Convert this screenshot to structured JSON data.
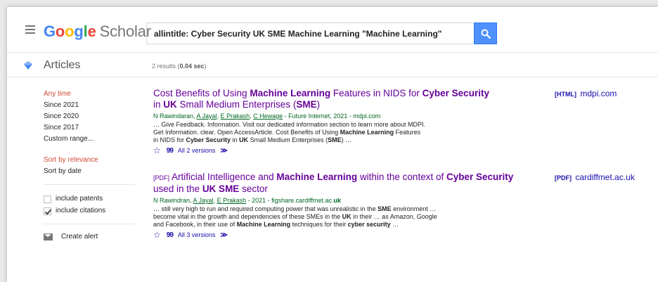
{
  "header": {
    "logo": {
      "google_letters": [
        "G",
        "o",
        "o",
        "g",
        "l",
        "e"
      ],
      "scholar": "Scholar"
    },
    "search": {
      "query": "allintitle: Cyber Security UK SME Machine Learning \"Machine Learning\""
    }
  },
  "subheader": {
    "section_label": "Articles",
    "results_prefix": "2 results (",
    "results_time": "0.04 sec",
    "results_suffix": ")"
  },
  "sidebar": {
    "time_filters": [
      "Any time",
      "Since 2021",
      "Since 2020",
      "Since 2017",
      "Custom range..."
    ],
    "sort_options": [
      "Sort by relevance",
      "Sort by date"
    ],
    "checks": [
      {
        "label": "include patents",
        "checked": false
      },
      {
        "label": "include citations",
        "checked": true
      }
    ],
    "create_alert": "Create alert"
  },
  "results": [
    {
      "title_parts": [
        {
          "t": "Cost Benefits of Using ",
          "b": false
        },
        {
          "t": "Machine Learning",
          "b": true
        },
        {
          "t": " Features in NIDS for ",
          "b": false
        },
        {
          "t": "Cyber Security",
          "b": true
        },
        {
          "t": " in ",
          "b": false
        },
        {
          "t": "UK",
          "b": true
        },
        {
          "t": " Small Medium Enterprises (",
          "b": false
        },
        {
          "t": "SME",
          "b": true
        },
        {
          "t": ")",
          "b": false
        }
      ],
      "authors": {
        "plain_lead": "N Rawindaran, ",
        "linked": [
          "A Jayal",
          "E Prakash",
          "C Hewage"
        ],
        "rest": " - Future Internet, 2021 - mdpi.com"
      },
      "snippet_lines": [
        [
          {
            "t": "… Give Feedback. Information. Visit our dedicated information section to learn more about MDPI.",
            "b": false
          }
        ],
        [
          {
            "t": "Get Information. clear. Open AccessArticle. Cost Benefits of Using ",
            "b": false
          },
          {
            "t": "Machine Learning",
            "b": true
          },
          {
            "t": " Features",
            "b": false
          }
        ],
        [
          {
            "t": "in NIDS for ",
            "b": false
          },
          {
            "t": "Cyber Security",
            "b": true
          },
          {
            "t": " in ",
            "b": false
          },
          {
            "t": "UK",
            "b": true
          },
          {
            "t": " Small Medium Enterprises (",
            "b": false
          },
          {
            "t": "SME",
            "b": true
          },
          {
            "t": ") …",
            "b": false
          }
        ]
      ],
      "versions": "All 2 versions",
      "side_tag": "[HTML]",
      "side_domain": "mdpi.com"
    },
    {
      "pdf_tag": "[PDF]",
      "title_parts": [
        {
          "t": "Artificial Intelligence and ",
          "b": false
        },
        {
          "t": "Machine Learning",
          "b": true
        },
        {
          "t": " within the context of ",
          "b": false
        },
        {
          "t": "Cyber Security",
          "b": true
        },
        {
          "t": " used in the ",
          "b": false
        },
        {
          "t": "UK SME",
          "b": true
        },
        {
          "t": " sector",
          "b": false
        }
      ],
      "authors": {
        "plain_lead": "N Rawindran, ",
        "linked": [
          "A Jayal",
          "E Prakash"
        ],
        "rest": " - 2021 - figshare.cardiffmet.ac.",
        "rest_bold": "uk"
      },
      "snippet_lines": [
        [
          {
            "t": "… still very high to run and required computing power that was unrealistic in the ",
            "b": false
          },
          {
            "t": "SME",
            "b": true
          },
          {
            "t": " environment …",
            "b": false
          }
        ],
        [
          {
            "t": "become vital in the growth and dependencies of these SMEs in the ",
            "b": false
          },
          {
            "t": "UK",
            "b": true
          },
          {
            "t": " in their … as Amazon, Google",
            "b": false
          }
        ],
        [
          {
            "t": "and Facebook, in their use of ",
            "b": false
          },
          {
            "t": "Machine Learning",
            "b": true
          },
          {
            "t": " techniques for their ",
            "b": false
          },
          {
            "t": "cyber security",
            "b": true
          },
          {
            "t": " …",
            "b": false
          }
        ]
      ],
      "versions": "All 3 versions",
      "side_tag": "[PDF]",
      "side_domain": "cardiffmet.ac.uk"
    }
  ],
  "icons": {
    "menu": "hamburger-menu-icon",
    "search": "search-icon",
    "articles": "articles-icon",
    "star": "☆",
    "cite": "99",
    "related": "≫",
    "mail": "mail-icon"
  },
  "colors": {
    "title": "#660099",
    "link": "#1a0dab",
    "authors": "#006621",
    "active_filter": "#d14836",
    "search_button": "#4d90fe"
  }
}
